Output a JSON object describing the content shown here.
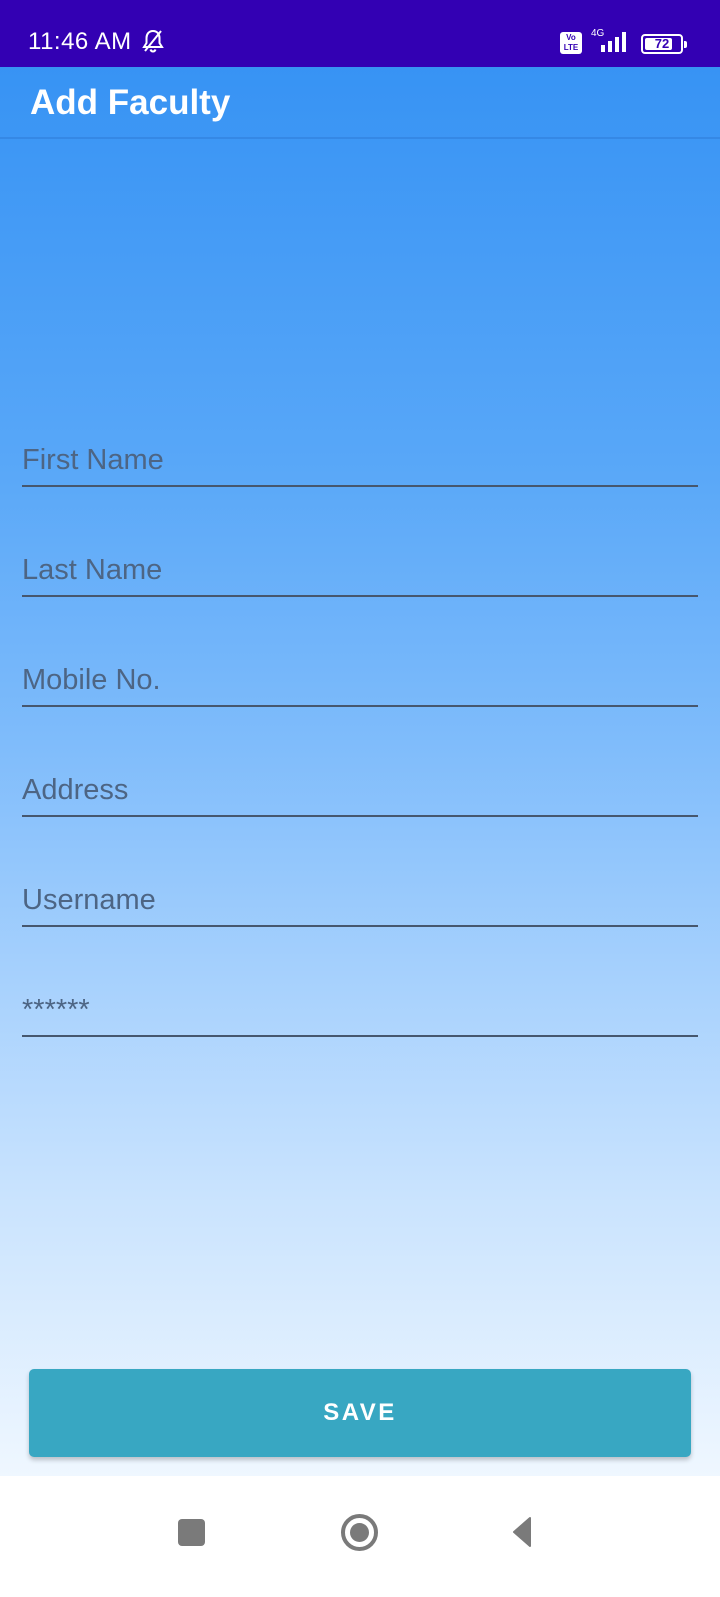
{
  "status_bar": {
    "time": "11:46 AM",
    "network_label": "4G",
    "volte_label": "Vo LTE",
    "battery_level": "72",
    "icons": [
      "bell-off-icon",
      "volte-icon",
      "signal-icon",
      "battery-icon"
    ]
  },
  "app_bar": {
    "title": "Add Faculty"
  },
  "form": {
    "first_name": {
      "placeholder": "First Name",
      "value": ""
    },
    "last_name": {
      "placeholder": "Last Name",
      "value": ""
    },
    "mobile": {
      "placeholder": "Mobile No.",
      "value": ""
    },
    "address": {
      "placeholder": "Address",
      "value": ""
    },
    "username": {
      "placeholder": "Username",
      "value": ""
    },
    "password": {
      "placeholder": "******",
      "value": ""
    }
  },
  "actions": {
    "save_label": "SAVE"
  },
  "nav_bar": {
    "icons": [
      "recents-icon",
      "home-icon",
      "back-icon"
    ]
  },
  "colors": {
    "status_bar": "#3300b3",
    "gradient_top": "#3793f4",
    "gradient_bottom": "#eff7ff",
    "save_button": "#38a7c2",
    "field_underline": "#46576e"
  }
}
